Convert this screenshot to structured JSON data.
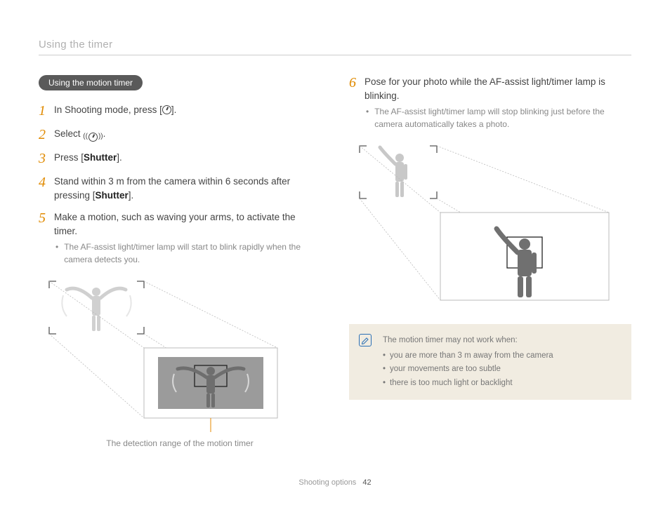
{
  "header": "Using the timer",
  "pill": "Using the motion timer",
  "left_steps": [
    {
      "num": "1",
      "pre": "In Shooting mode, press [",
      "icon": "timer",
      "post": "]."
    },
    {
      "num": "2",
      "pre": "Select ",
      "icon": "motion",
      "post": "."
    },
    {
      "num": "3",
      "pre": "Press [",
      "bold": "Shutter",
      "post": "]."
    },
    {
      "num": "4",
      "pre": "Stand within 3 m from the camera within 6 seconds after pressing [",
      "bold": "Shutter",
      "post": "]."
    },
    {
      "num": "5",
      "pre": "Make a motion, such as waving your arms, to activate the timer.",
      "bold": "",
      "post": "",
      "sub": "The AF-assist light/timer lamp will start to blink rapidly when the camera detects you."
    }
  ],
  "left_caption": "The detection range of the motion timer",
  "right_steps": [
    {
      "num": "6",
      "pre": "Pose for your photo while the AF-assist light/timer lamp is blinking.",
      "bold": "",
      "post": "",
      "sub": "The AF-assist light/timer lamp will stop blinking just before the camera automatically takes a photo."
    }
  ],
  "note": {
    "lead": "The motion timer may not work when:",
    "items": [
      "you are more than 3 m away from the camera",
      "your movements are too subtle",
      "there is too much light or backlight"
    ]
  },
  "footer": {
    "section": "Shooting options",
    "page": "42"
  }
}
